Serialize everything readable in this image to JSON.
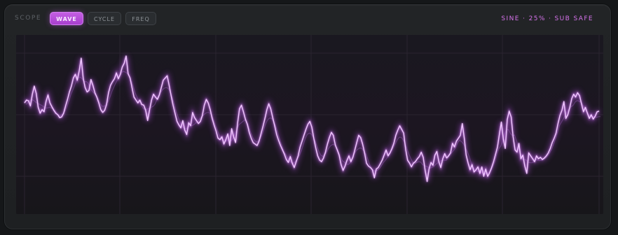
{
  "scope": {
    "label": "SCOPE",
    "tabs": [
      {
        "label": "WAVE",
        "active": true
      },
      {
        "label": "CYCLE",
        "active": false
      },
      {
        "label": "FREQ",
        "active": false
      }
    ],
    "status": "SINE · 25% · SUB SAFE"
  },
  "colors": {
    "accent": "#c45fe2",
    "status": "#d773ec",
    "trace": "#f0c8ff",
    "trace_glow": "#b14fe0",
    "background": "#1e2022"
  },
  "waveform": {
    "samples": [
      0.16,
      0.2,
      0.19,
      0.12,
      0.28,
      0.39,
      0.29,
      0.1,
      0.02,
      0.07,
      0.04,
      0.18,
      0.27,
      0.16,
      0.11,
      0.06,
      0.02,
      0.0,
      -0.04,
      -0.03,
      0.02,
      0.12,
      0.21,
      0.31,
      0.39,
      0.5,
      0.55,
      0.47,
      0.6,
      0.77,
      0.5,
      0.37,
      0.31,
      0.33,
      0.48,
      0.4,
      0.3,
      0.24,
      0.16,
      0.07,
      0.03,
      0.06,
      0.14,
      0.3,
      0.4,
      0.45,
      0.49,
      0.57,
      0.49,
      0.55,
      0.65,
      0.7,
      0.8,
      0.56,
      0.5,
      0.37,
      0.24,
      0.2,
      0.16,
      0.2,
      0.14,
      0.13,
      0.06,
      -0.08,
      0.07,
      0.2,
      0.28,
      0.24,
      0.21,
      0.27,
      0.37,
      0.47,
      0.5,
      0.53,
      0.4,
      0.26,
      0.13,
      0.02,
      -0.09,
      -0.14,
      -0.18,
      -0.08,
      -0.21,
      -0.27,
      -0.11,
      -0.15,
      0.03,
      -0.04,
      -0.08,
      -0.12,
      -0.09,
      -0.01,
      0.13,
      0.21,
      0.16,
      0.07,
      -0.05,
      -0.14,
      -0.22,
      -0.32,
      -0.34,
      -0.3,
      -0.4,
      -0.34,
      -0.26,
      -0.42,
      -0.19,
      -0.3,
      -0.38,
      -0.12,
      0.08,
      0.13,
      0.04,
      -0.06,
      -0.13,
      -0.24,
      -0.32,
      -0.38,
      -0.4,
      -0.42,
      -0.36,
      -0.26,
      -0.16,
      -0.05,
      0.07,
      0.15,
      0.08,
      -0.04,
      -0.15,
      -0.27,
      -0.35,
      -0.42,
      -0.48,
      -0.54,
      -0.61,
      -0.65,
      -0.57,
      -0.66,
      -0.72,
      -0.64,
      -0.56,
      -0.44,
      -0.36,
      -0.28,
      -0.2,
      -0.13,
      -0.09,
      -0.17,
      -0.32,
      -0.45,
      -0.56,
      -0.62,
      -0.64,
      -0.59,
      -0.51,
      -0.4,
      -0.31,
      -0.24,
      -0.28,
      -0.41,
      -0.48,
      -0.55,
      -0.68,
      -0.76,
      -0.7,
      -0.62,
      -0.56,
      -0.64,
      -0.58,
      -0.48,
      -0.38,
      -0.28,
      -0.31,
      -0.4,
      -0.52,
      -0.66,
      -0.7,
      -0.72,
      -0.75,
      -0.86,
      -0.74,
      -0.72,
      -0.67,
      -0.62,
      -0.55,
      -0.48,
      -0.56,
      -0.52,
      -0.46,
      -0.39,
      -0.28,
      -0.21,
      -0.15,
      -0.2,
      -0.25,
      -0.47,
      -0.62,
      -0.66,
      -0.71,
      -0.66,
      -0.64,
      -0.6,
      -0.57,
      -0.51,
      -0.58,
      -0.76,
      -0.91,
      -0.74,
      -0.65,
      -0.69,
      -0.55,
      -0.5,
      -0.64,
      -0.72,
      -0.6,
      -0.53,
      -0.59,
      -0.56,
      -0.52,
      -0.39,
      -0.44,
      -0.36,
      -0.32,
      -0.28,
      -0.12,
      -0.32,
      -0.55,
      -0.66,
      -0.75,
      -0.68,
      -0.78,
      -0.75,
      -0.71,
      -0.8,
      -0.71,
      -0.84,
      -0.74,
      -0.84,
      -0.79,
      -0.72,
      -0.64,
      -0.54,
      -0.44,
      -0.26,
      -0.1,
      -0.33,
      -0.46,
      -0.07,
      0.05,
      -0.03,
      -0.3,
      -0.48,
      -0.51,
      -0.39,
      -0.6,
      -0.55,
      -0.7,
      -0.8,
      -0.52,
      -0.56,
      -0.6,
      -0.64,
      -0.56,
      -0.6,
      -0.58,
      -0.61,
      -0.59,
      -0.56,
      -0.52,
      -0.46,
      -0.38,
      -0.32,
      -0.25,
      -0.12,
      -0.01,
      0.06,
      0.18,
      -0.05,
      0.0,
      0.1,
      0.22,
      0.28,
      0.24,
      0.3,
      0.26,
      0.15,
      0.04,
      0.1,
      0.02,
      -0.05,
      0.0,
      -0.06,
      -0.02,
      0.04,
      0.05
    ]
  }
}
